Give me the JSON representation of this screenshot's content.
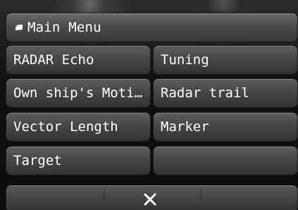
{
  "header": {
    "title": "Main Menu",
    "icon": "menu-flag-icon"
  },
  "menu": {
    "radar_echo": "RADAR Echo",
    "tuning": "Tuning",
    "own_ship_motion": "Own ship's Moti…",
    "radar_trail": "Radar trail",
    "vector_length": "Vector Length",
    "marker": "Marker",
    "target": "Target",
    "empty": ""
  },
  "footer": {
    "close_icon": "close-icon"
  },
  "colors": {
    "button_top": "#5e5e5e",
    "button_bottom": "#333333",
    "text": "#ffffff",
    "background": "#101010"
  }
}
